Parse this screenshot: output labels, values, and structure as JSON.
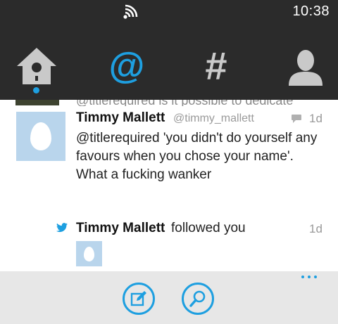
{
  "status_bar": {
    "time": "10:38",
    "signal_icon": "wifi-signal-icon"
  },
  "tabs": [
    {
      "name": "home",
      "icon": "birdhouse-icon",
      "active": true
    },
    {
      "name": "mentions",
      "glyph": "@",
      "icon": "at-icon",
      "active": false,
      "color": "#1e9fe0"
    },
    {
      "name": "discover",
      "glyph": "#",
      "icon": "hash-icon",
      "active": false
    },
    {
      "name": "profile",
      "icon": "person-icon",
      "active": false
    }
  ],
  "clipped_tweet": {
    "text": "@titlerequired is it possible to dedicate"
  },
  "tweet": {
    "name": "Timmy Mallett",
    "handle": "@timmy_mallett",
    "time": "1d",
    "text": "@titlerequired 'you didn't do yourself any favours when you chose your name'. What a fucking wanker",
    "icon": "reply-bubble-icon"
  },
  "follow_notification": {
    "name": "Timmy Mallett",
    "action": "followed you",
    "time": "1d",
    "icon": "twitter-bird-icon"
  },
  "app_bar": {
    "buttons": [
      {
        "name": "compose",
        "icon": "compose-icon"
      },
      {
        "name": "search",
        "icon": "search-icon"
      }
    ],
    "more_icon": "ellipsis-icon"
  },
  "colors": {
    "accent": "#1e9fe0",
    "bar_background": "#2b2b2b",
    "app_bar_background": "#e7e7e7",
    "avatar_background": "#b9d5ec"
  }
}
